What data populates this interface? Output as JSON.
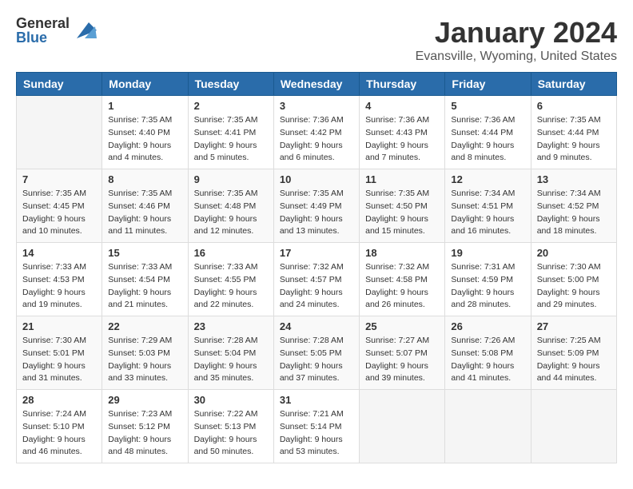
{
  "logo": {
    "general": "General",
    "blue": "Blue"
  },
  "title": "January 2024",
  "location": "Evansville, Wyoming, United States",
  "days_of_week": [
    "Sunday",
    "Monday",
    "Tuesday",
    "Wednesday",
    "Thursday",
    "Friday",
    "Saturday"
  ],
  "weeks": [
    [
      {
        "day": "",
        "info": ""
      },
      {
        "day": "1",
        "info": "Sunrise: 7:35 AM\nSunset: 4:40 PM\nDaylight: 9 hours\nand 4 minutes."
      },
      {
        "day": "2",
        "info": "Sunrise: 7:35 AM\nSunset: 4:41 PM\nDaylight: 9 hours\nand 5 minutes."
      },
      {
        "day": "3",
        "info": "Sunrise: 7:36 AM\nSunset: 4:42 PM\nDaylight: 9 hours\nand 6 minutes."
      },
      {
        "day": "4",
        "info": "Sunrise: 7:36 AM\nSunset: 4:43 PM\nDaylight: 9 hours\nand 7 minutes."
      },
      {
        "day": "5",
        "info": "Sunrise: 7:36 AM\nSunset: 4:44 PM\nDaylight: 9 hours\nand 8 minutes."
      },
      {
        "day": "6",
        "info": "Sunrise: 7:35 AM\nSunset: 4:44 PM\nDaylight: 9 hours\nand 9 minutes."
      }
    ],
    [
      {
        "day": "7",
        "info": "Sunrise: 7:35 AM\nSunset: 4:45 PM\nDaylight: 9 hours\nand 10 minutes."
      },
      {
        "day": "8",
        "info": "Sunrise: 7:35 AM\nSunset: 4:46 PM\nDaylight: 9 hours\nand 11 minutes."
      },
      {
        "day": "9",
        "info": "Sunrise: 7:35 AM\nSunset: 4:48 PM\nDaylight: 9 hours\nand 12 minutes."
      },
      {
        "day": "10",
        "info": "Sunrise: 7:35 AM\nSunset: 4:49 PM\nDaylight: 9 hours\nand 13 minutes."
      },
      {
        "day": "11",
        "info": "Sunrise: 7:35 AM\nSunset: 4:50 PM\nDaylight: 9 hours\nand 15 minutes."
      },
      {
        "day": "12",
        "info": "Sunrise: 7:34 AM\nSunset: 4:51 PM\nDaylight: 9 hours\nand 16 minutes."
      },
      {
        "day": "13",
        "info": "Sunrise: 7:34 AM\nSunset: 4:52 PM\nDaylight: 9 hours\nand 18 minutes."
      }
    ],
    [
      {
        "day": "14",
        "info": "Sunrise: 7:33 AM\nSunset: 4:53 PM\nDaylight: 9 hours\nand 19 minutes."
      },
      {
        "day": "15",
        "info": "Sunrise: 7:33 AM\nSunset: 4:54 PM\nDaylight: 9 hours\nand 21 minutes."
      },
      {
        "day": "16",
        "info": "Sunrise: 7:33 AM\nSunset: 4:55 PM\nDaylight: 9 hours\nand 22 minutes."
      },
      {
        "day": "17",
        "info": "Sunrise: 7:32 AM\nSunset: 4:57 PM\nDaylight: 9 hours\nand 24 minutes."
      },
      {
        "day": "18",
        "info": "Sunrise: 7:32 AM\nSunset: 4:58 PM\nDaylight: 9 hours\nand 26 minutes."
      },
      {
        "day": "19",
        "info": "Sunrise: 7:31 AM\nSunset: 4:59 PM\nDaylight: 9 hours\nand 28 minutes."
      },
      {
        "day": "20",
        "info": "Sunrise: 7:30 AM\nSunset: 5:00 PM\nDaylight: 9 hours\nand 29 minutes."
      }
    ],
    [
      {
        "day": "21",
        "info": "Sunrise: 7:30 AM\nSunset: 5:01 PM\nDaylight: 9 hours\nand 31 minutes."
      },
      {
        "day": "22",
        "info": "Sunrise: 7:29 AM\nSunset: 5:03 PM\nDaylight: 9 hours\nand 33 minutes."
      },
      {
        "day": "23",
        "info": "Sunrise: 7:28 AM\nSunset: 5:04 PM\nDaylight: 9 hours\nand 35 minutes."
      },
      {
        "day": "24",
        "info": "Sunrise: 7:28 AM\nSunset: 5:05 PM\nDaylight: 9 hours\nand 37 minutes."
      },
      {
        "day": "25",
        "info": "Sunrise: 7:27 AM\nSunset: 5:07 PM\nDaylight: 9 hours\nand 39 minutes."
      },
      {
        "day": "26",
        "info": "Sunrise: 7:26 AM\nSunset: 5:08 PM\nDaylight: 9 hours\nand 41 minutes."
      },
      {
        "day": "27",
        "info": "Sunrise: 7:25 AM\nSunset: 5:09 PM\nDaylight: 9 hours\nand 44 minutes."
      }
    ],
    [
      {
        "day": "28",
        "info": "Sunrise: 7:24 AM\nSunset: 5:10 PM\nDaylight: 9 hours\nand 46 minutes."
      },
      {
        "day": "29",
        "info": "Sunrise: 7:23 AM\nSunset: 5:12 PM\nDaylight: 9 hours\nand 48 minutes."
      },
      {
        "day": "30",
        "info": "Sunrise: 7:22 AM\nSunset: 5:13 PM\nDaylight: 9 hours\nand 50 minutes."
      },
      {
        "day": "31",
        "info": "Sunrise: 7:21 AM\nSunset: 5:14 PM\nDaylight: 9 hours\nand 53 minutes."
      },
      {
        "day": "",
        "info": ""
      },
      {
        "day": "",
        "info": ""
      },
      {
        "day": "",
        "info": ""
      }
    ]
  ]
}
